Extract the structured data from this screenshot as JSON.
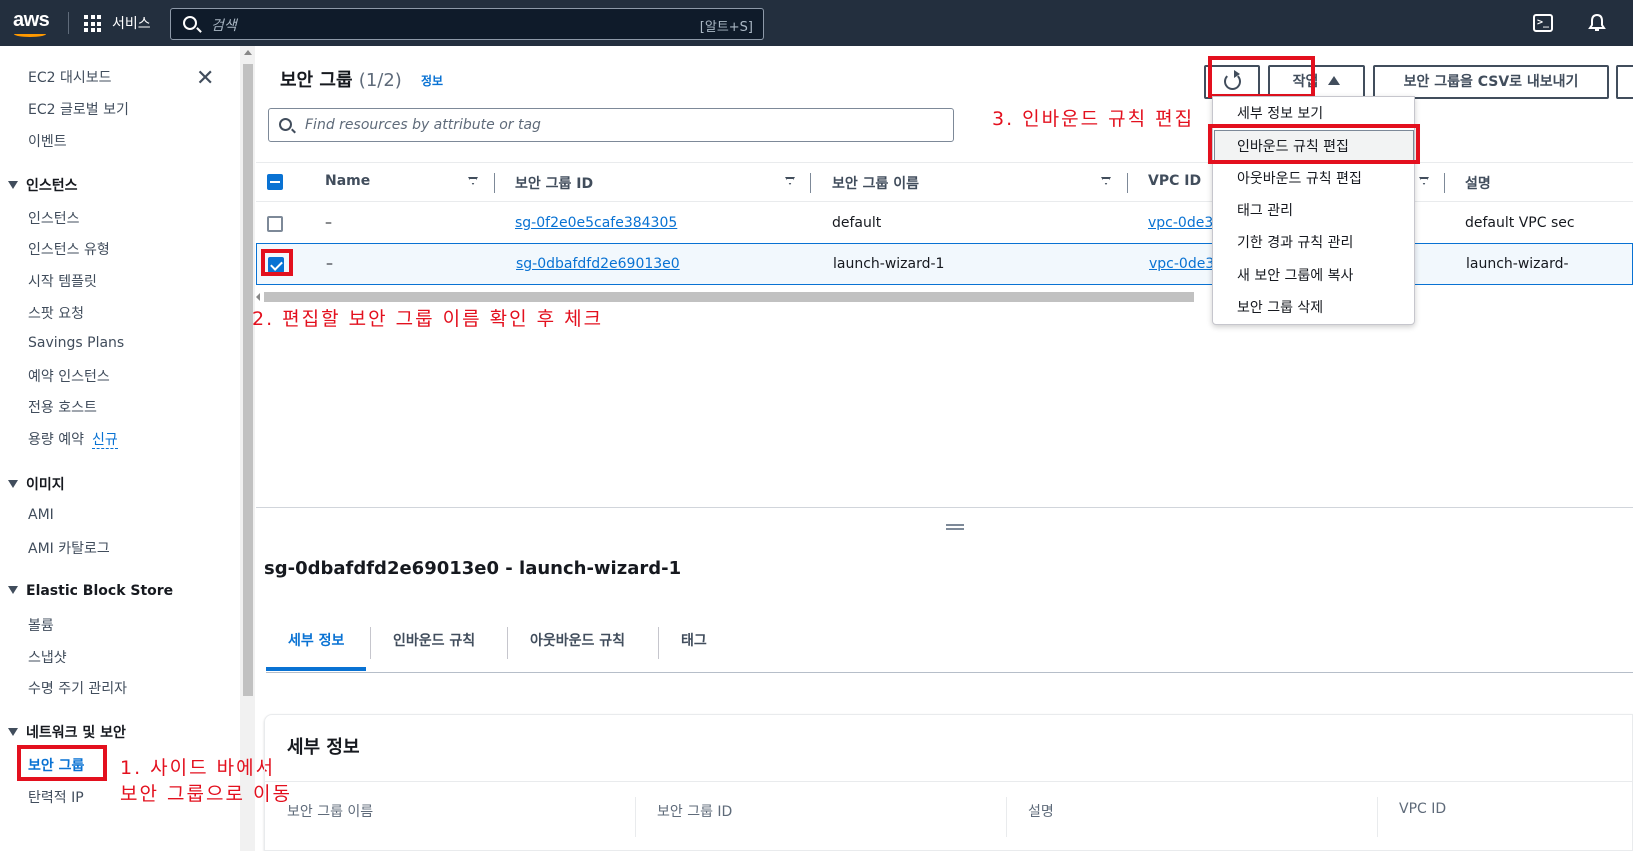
{
  "topbar": {
    "logo": "aws",
    "services_label": "서비스",
    "search_placeholder": "검색",
    "search_shortcut": "[알트+S]"
  },
  "sidebar": {
    "items_top": [
      "EC2 대시보드",
      "EC2 글로벌 보기",
      "이벤트"
    ],
    "sections": [
      {
        "title": "인스턴스",
        "items": [
          "인스턴스",
          "인스턴스 유형",
          "시작 템플릿",
          "스팟 요청",
          "Savings Plans",
          "예약 인스턴스",
          "전용 호스트",
          "용량 예약"
        ]
      },
      {
        "title": "이미지",
        "items": [
          "AMI",
          "AMI 카탈로그"
        ]
      },
      {
        "title": "Elastic Block Store",
        "items": [
          "볼륨",
          "스냅샷",
          "수명 주기 관리자"
        ]
      },
      {
        "title": "네트워크 및 보안",
        "items": [
          "보안 그룹",
          "탄력적 IP"
        ]
      }
    ],
    "new_badge": "신규"
  },
  "main": {
    "title": "보안 그룹",
    "count": "(1/2)",
    "info": "정보",
    "actions_label": "작업",
    "export_label": "보안 그룹을 CSV로 내보내기",
    "filter_placeholder": "Find resources by attribute or tag"
  },
  "table": {
    "columns": [
      "Name",
      "보안 그룹 ID",
      "보안 그룹 이름",
      "VPC ID",
      "설명"
    ],
    "rows": [
      {
        "name": "–",
        "id": "sg-0f2e0e5cafe384305",
        "group_name": "default",
        "vpc": "vpc-0de3",
        "desc": "default VPC sec",
        "checked": false
      },
      {
        "name": "–",
        "id": "sg-0dbafdfd2e69013e0",
        "group_name": "launch-wizard-1",
        "vpc": "vpc-0de3",
        "desc": "launch-wizard-",
        "checked": true
      }
    ]
  },
  "dropdown": {
    "items": [
      "세부 정보 보기",
      "인바운드 규칙 편집",
      "아웃바운드 규칙 편집",
      "태그 관리",
      "기한 경과 규칙 관리",
      "새 보안 그룹에 복사",
      "보안 그룹 삭제"
    ]
  },
  "annotations": {
    "step1_line1": "1. 사이드 바에서",
    "step1_line2": "보안 그룹으로 이동",
    "step2": "2. 편집할 보안 그룹 이름 확인 후 체크",
    "step3": "3. 인바운드 규칙 편집"
  },
  "detail": {
    "title": "sg-0dbafdfd2e69013e0 - launch-wizard-1",
    "tabs": [
      "세부 정보",
      "인바운드 규칙",
      "아웃바운드 규칙",
      "태그"
    ],
    "panel_title": "세부 정보",
    "fields": [
      "보안 그룹 이름",
      "보안 그룹 ID",
      "설명",
      "VPC ID"
    ]
  },
  "colors": {
    "accent": "#0972d3",
    "topbar": "#232f3e",
    "annotation": "#e3101e"
  }
}
